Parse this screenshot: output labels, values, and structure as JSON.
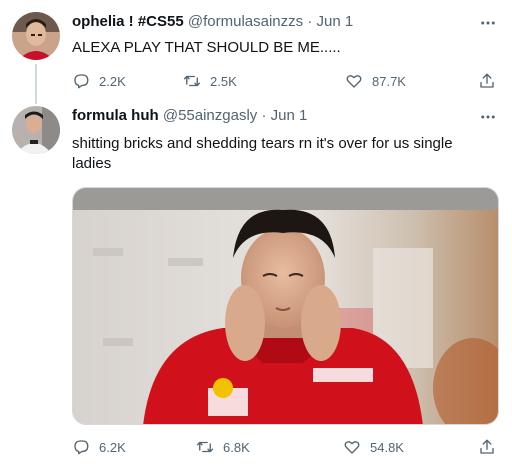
{
  "tweets": [
    {
      "name": "ophelia ! #CS55",
      "handle": "@formulasainzzs",
      "dot": "·",
      "date": "Jun 1",
      "text": "ALEXA PLAY THAT SHOULD BE ME.....",
      "replies": "2.2K",
      "retweets": "2.5K",
      "likes": "87.7K"
    },
    {
      "name": "formula huh",
      "handle": "@55ainzgasly",
      "dot": "·",
      "date": "Jun 1",
      "text": "shitting bricks and shedding tears rn it's over for us single ladies",
      "replies": "6.2K",
      "retweets": "6.8K",
      "likes": "54.8K"
    }
  ],
  "icons": {
    "more": "more-icon",
    "reply": "reply-icon",
    "retweet": "retweet-icon",
    "like": "like-icon",
    "share": "share-icon"
  },
  "colors": {
    "text": "#0f1419",
    "secondary": "#536471",
    "ferrari_red": "#d0101a",
    "thread_line": "#cfd9de"
  }
}
